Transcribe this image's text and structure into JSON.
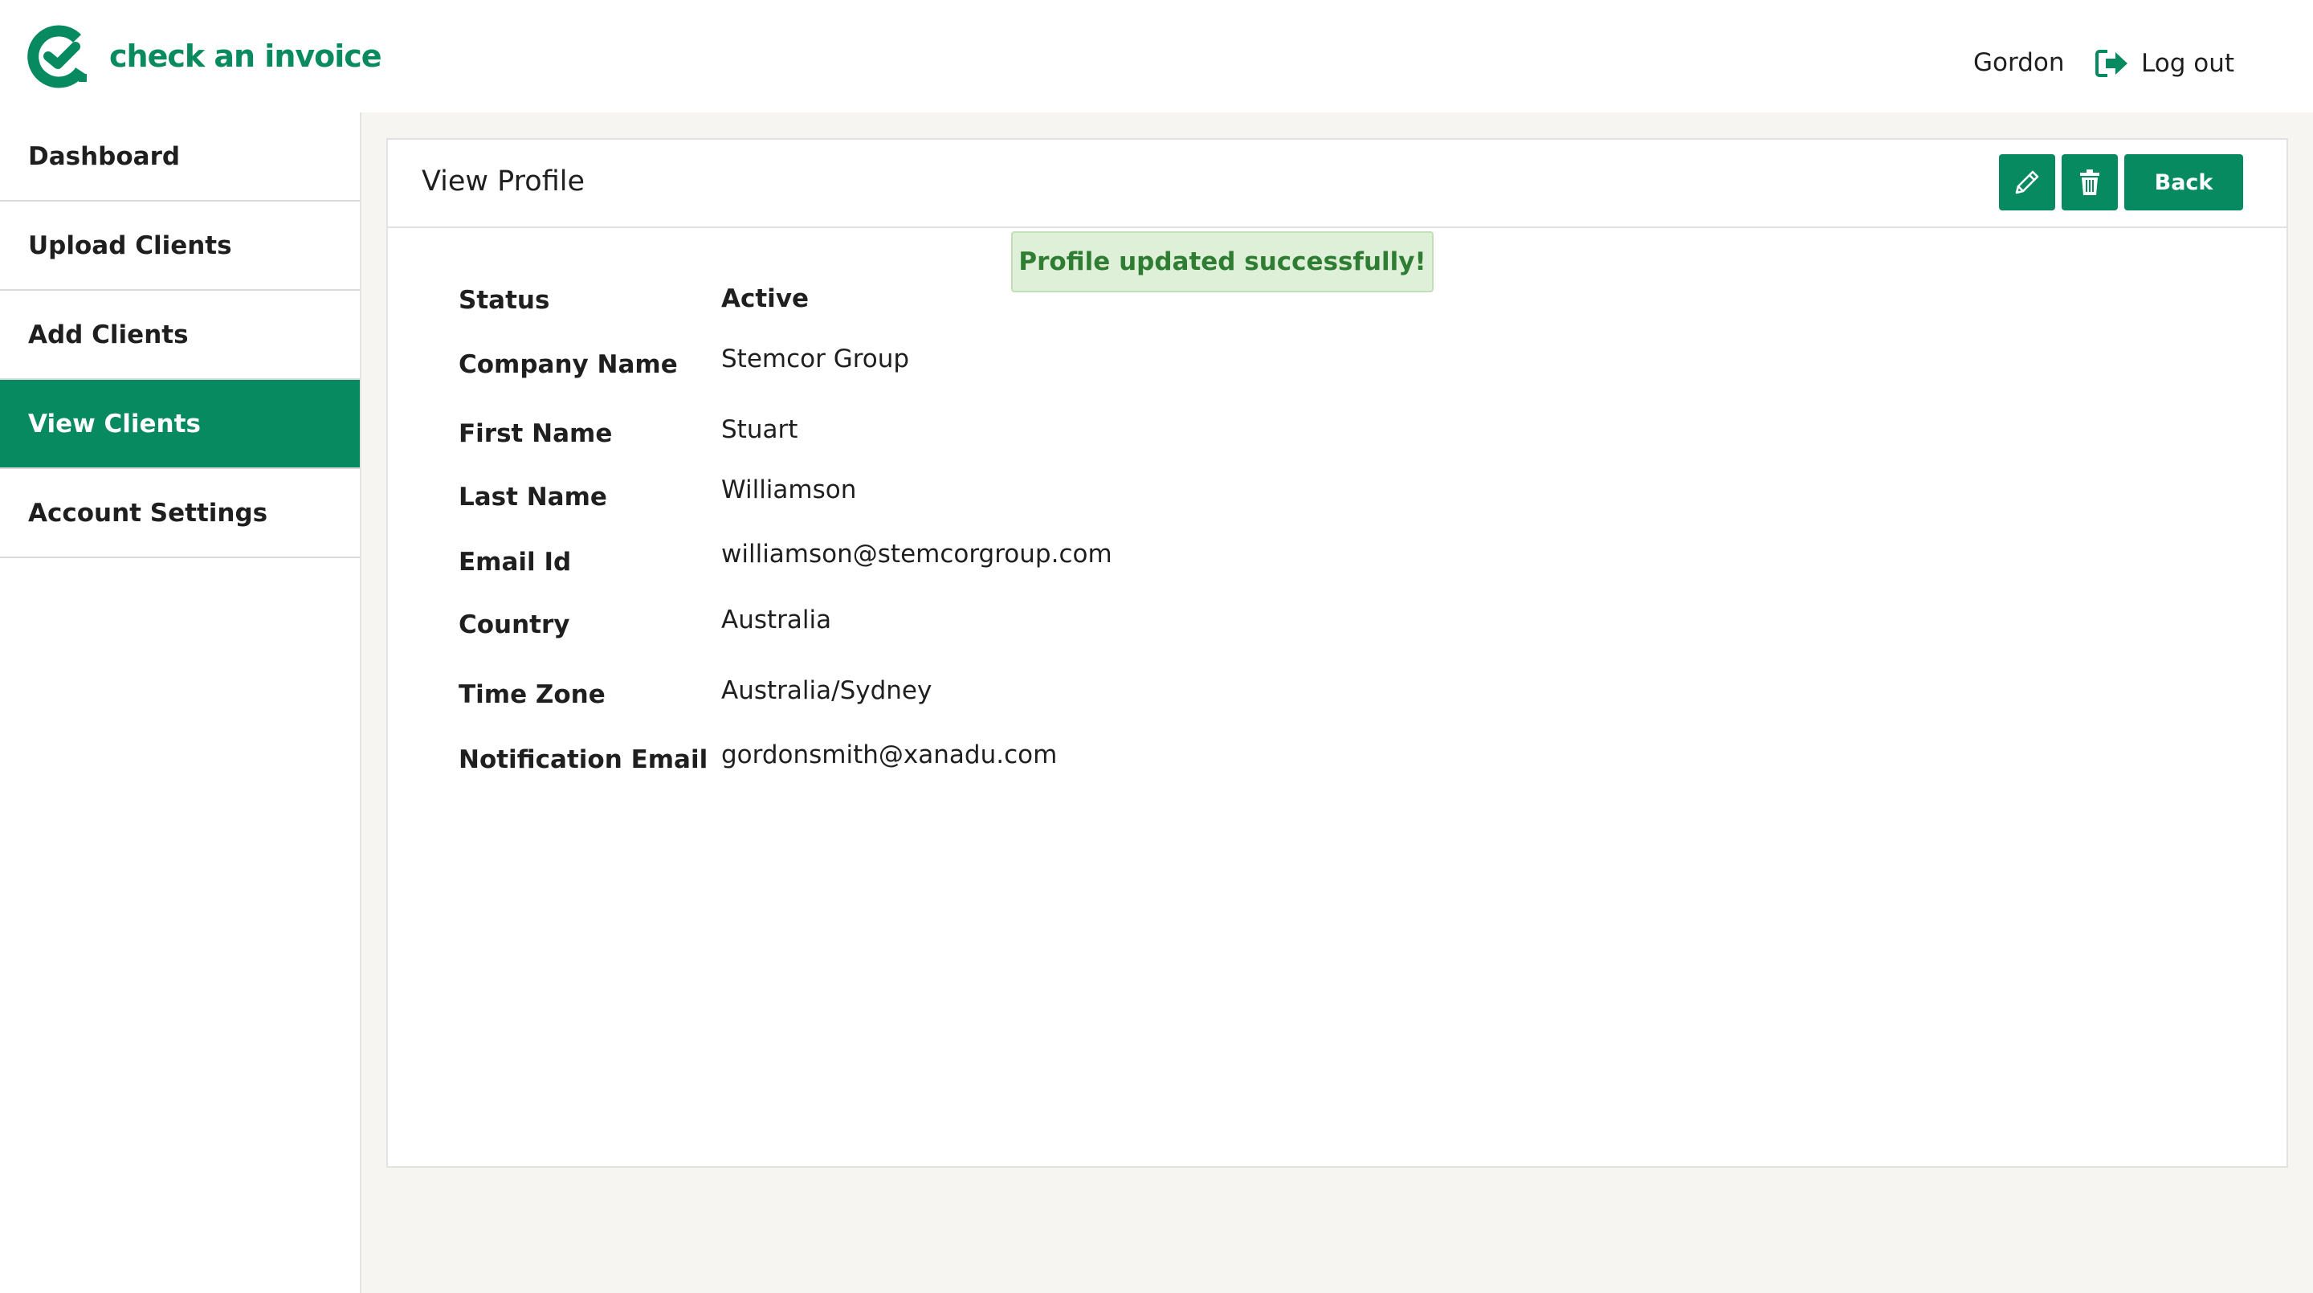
{
  "app": {
    "logo_text": "check an invoice",
    "brand_color": "#078a5f"
  },
  "header": {
    "user_name": "Gordon",
    "logout_label": "Log out",
    "logout_icon": "sign-out-icon"
  },
  "sidebar": {
    "items": [
      {
        "label": "Dashboard",
        "active": false
      },
      {
        "label": "Upload Clients",
        "active": false
      },
      {
        "label": "Add Clients",
        "active": false
      },
      {
        "label": "View Clients",
        "active": true
      },
      {
        "label": "Account Settings",
        "active": false
      }
    ]
  },
  "main": {
    "title": "View Profile",
    "buttons": {
      "edit_icon": "pencil-icon",
      "delete_icon": "trash-icon",
      "back_label": "Back"
    },
    "alert": "Profile updated successfully!",
    "fields": [
      {
        "label": "Status",
        "value": "Active"
      },
      {
        "label": "Company Name",
        "value": "Stemcor Group"
      },
      {
        "label": "First Name",
        "value": "Stuart"
      },
      {
        "label": "Last Name",
        "value": "Williamson"
      },
      {
        "label": "Email Id",
        "value": "williamson@stemcorgroup.com"
      },
      {
        "label": "Country",
        "value": "Australia"
      },
      {
        "label": "Time Zone",
        "value": "Australia/Sydney"
      },
      {
        "label": "Notification Email",
        "value": "gordonsmith@xanadu.com"
      }
    ]
  }
}
